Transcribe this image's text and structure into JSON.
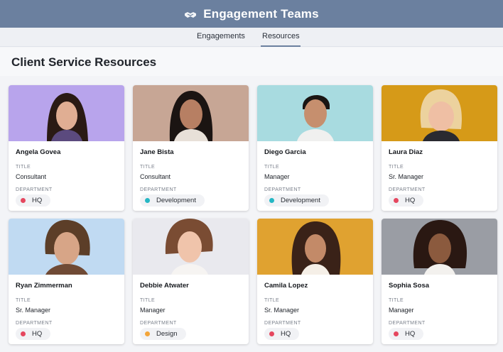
{
  "app": {
    "title": "Engagement Teams",
    "logo_icon": "handshake-icon"
  },
  "tabs": [
    {
      "label": "Engagements",
      "active": false
    },
    {
      "label": "Resources",
      "active": true
    }
  ],
  "page": {
    "title": "Client Service Resources",
    "labels": {
      "title": "TITLE",
      "department": "DEPARTMENT"
    }
  },
  "colors": {
    "header": "#6b809f",
    "dept_hq": "#e5475f",
    "dept_development": "#25b7c4",
    "dept_design": "#f3a53a"
  },
  "people": [
    {
      "name": "Angela Govea",
      "title": "Consultant",
      "department": "HQ",
      "dept_color": "#e5475f",
      "photo_bg": "#b8a4ec"
    },
    {
      "name": "Jane Bista",
      "title": "Consultant",
      "department": "Development",
      "dept_color": "#25b7c4",
      "photo_bg": "#c7a695"
    },
    {
      "name": "Diego Garcia",
      "title": "Manager",
      "department": "Development",
      "dept_color": "#25b7c4",
      "photo_bg": "#a8dbe0"
    },
    {
      "name": "Laura Diaz",
      "title": "Sr. Manager",
      "department": "HQ",
      "dept_color": "#e5475f",
      "photo_bg": "#d69a18"
    },
    {
      "name": "Ryan Zimmerman",
      "title": "Sr. Manager",
      "department": "HQ",
      "dept_color": "#e5475f",
      "photo_bg": "#c0daf2"
    },
    {
      "name": "Debbie Atwater",
      "title": "Manager",
      "department": "Design",
      "dept_color": "#f3a53a",
      "photo_bg": "#e9e9ee"
    },
    {
      "name": "Camila Lopez",
      "title": "Sr. Manager",
      "department": "HQ",
      "dept_color": "#e5475f",
      "photo_bg": "#e0a230"
    },
    {
      "name": "Sophia Sosa",
      "title": "Manager",
      "department": "HQ",
      "dept_color": "#e5475f",
      "photo_bg": "#9a9da4"
    }
  ]
}
